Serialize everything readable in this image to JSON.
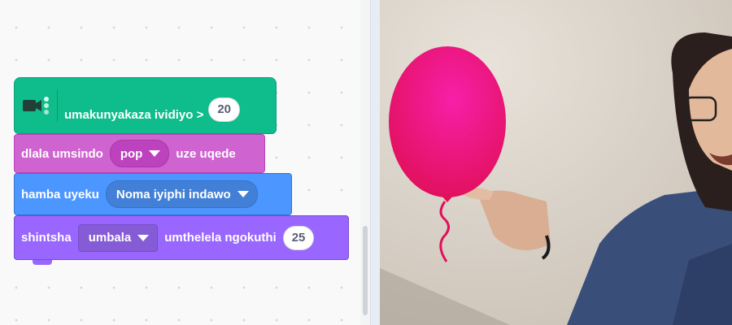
{
  "colors": {
    "events_video": "#0fbd8c",
    "sound": "#cf63cf",
    "motion": "#4c97ff",
    "looks": "#9966ff",
    "balloon": "#f0166c"
  },
  "blocks": {
    "video_hat": {
      "icon": "video-sensing-icon",
      "label": "umakunyakaza ividiyo >",
      "value": "20"
    },
    "sound": {
      "label_before": "dlala umsindo",
      "dropdown": "pop",
      "label_after": "uze uqede"
    },
    "motion": {
      "label": "hamba uyeku",
      "dropdown": "Noma iyiphi indawo"
    },
    "looks": {
      "label_before": "shintsha",
      "dropdown": "umbala",
      "label_after": "umthelela ngokuthi",
      "value": "25"
    }
  },
  "stage": {
    "sprite": "balloon",
    "backdrop": "webcam-video-feed"
  }
}
